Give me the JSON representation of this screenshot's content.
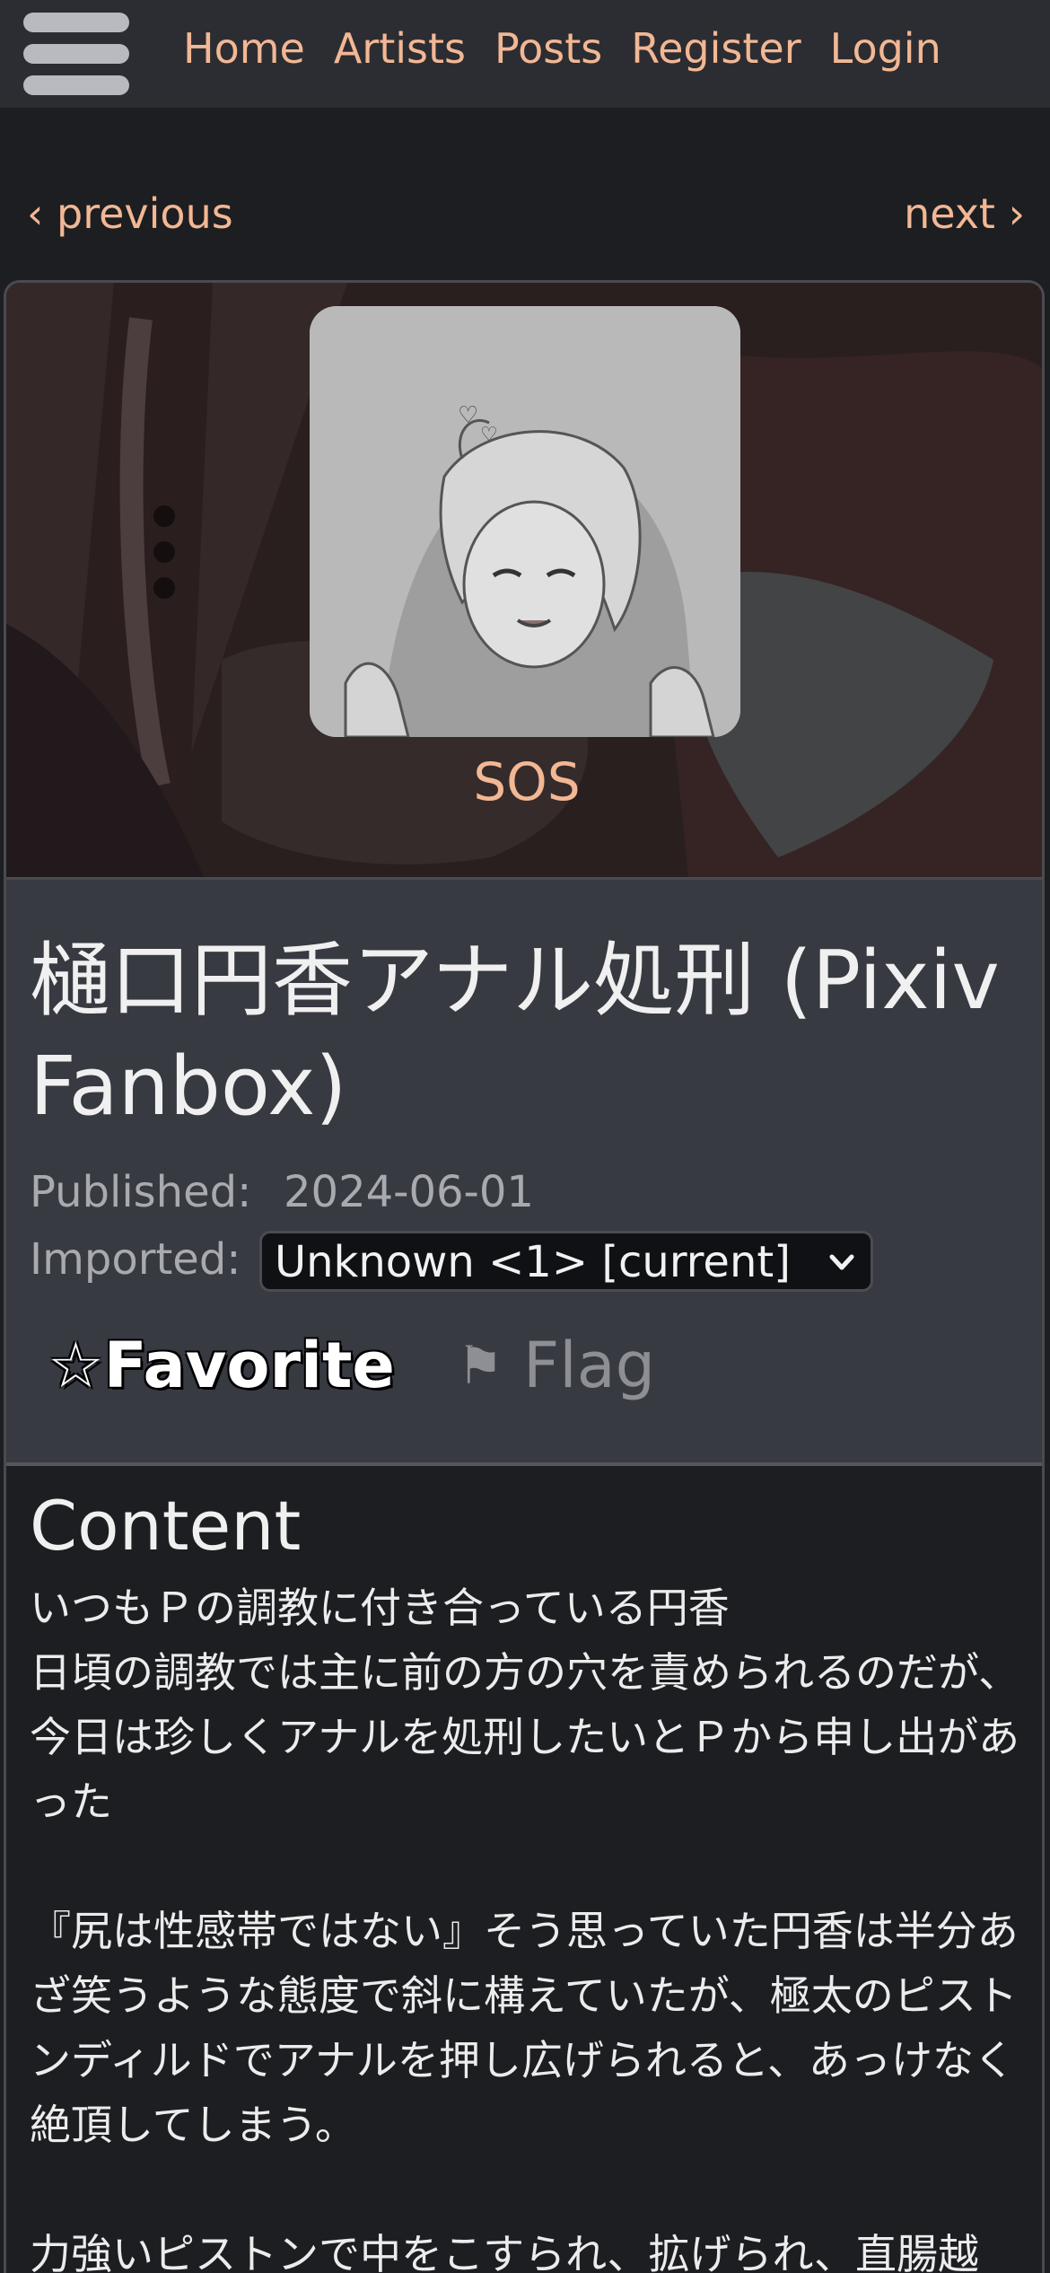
{
  "nav": {
    "links": [
      "Home",
      "Artists",
      "Posts",
      "Register",
      "Login"
    ]
  },
  "pager": {
    "previous": "‹ previous",
    "next": "next ›"
  },
  "artist": {
    "name": "SOS"
  },
  "post": {
    "title": "樋口円香アナル処刑 (Pixiv Fanbox)",
    "published_label": "Published:",
    "published_value": "2024-06-01",
    "imported_label": "Imported:",
    "imported_value": "Unknown <1> [current]",
    "favorite_icon": "☆",
    "favorite_label": "Favorite",
    "flag_icon": "⚑",
    "flag_label": "Flag"
  },
  "content": {
    "heading": "Content",
    "lines": [
      "いつもＰの調教に付き合っている円香",
      "日頃の調教では主に前の方の穴を責められるのだが、今日は珍しくアナルを処刑したいとＰから申し出があった",
      "",
      "『尻は性感帯ではない』そう思っていた円香は半分あざ笑うような態度で斜に構えていたが、極太のピストンディルドでアナルを押し広げられると、あっけなく絶頂してしまう。",
      "",
      "力強いピストンで中をこすられ、拡げられ、直腸越"
    ]
  },
  "colors": {
    "accent": "#f2b794",
    "navbar": "#2c2d32",
    "background": "#1d1e21",
    "panel": "#383a42",
    "muted_text": "#a9aab0"
  }
}
